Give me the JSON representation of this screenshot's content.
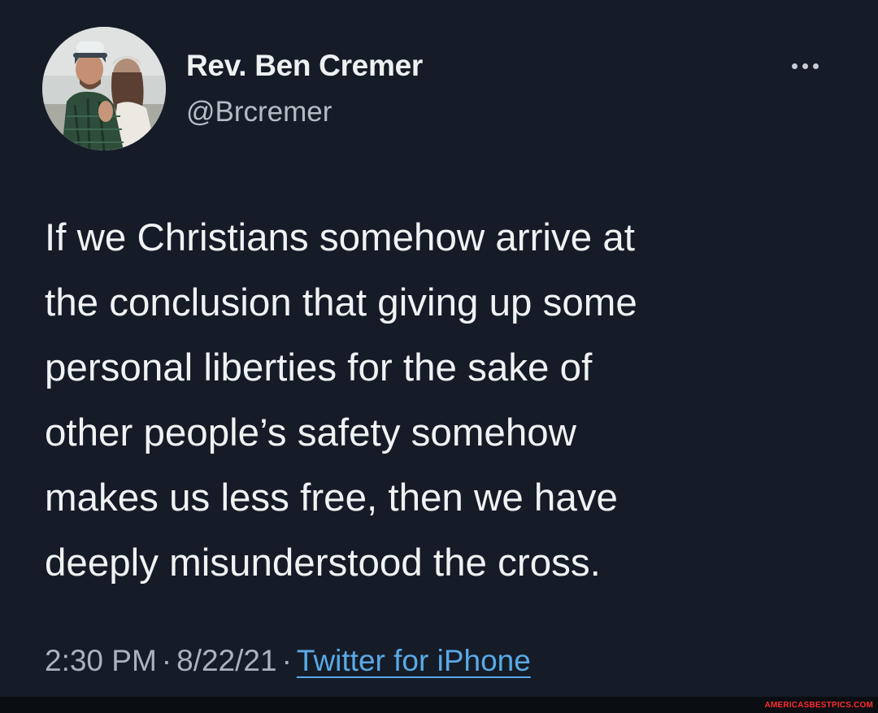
{
  "tweet": {
    "author": {
      "display_name": "Rev. Ben Cremer",
      "handle": "@Brcremer"
    },
    "more_icon": "ellipsis-icon",
    "text_lines": [
      "If we Christians somehow arrive at",
      "the conclusion that giving up some",
      "personal liberties for the sake of",
      "other people’s safety somehow",
      "makes us less free, then we have",
      "deeply misunderstood the cross."
    ],
    "time": "2:30 PM",
    "date": "8/22/21",
    "separator": "·",
    "source": "Twitter for iPhone"
  },
  "watermark": "AMERICASBESTPICS.COM",
  "colors": {
    "background": "#151c27",
    "link": "#5aa9e6",
    "watermark": "#ff2d2d"
  }
}
